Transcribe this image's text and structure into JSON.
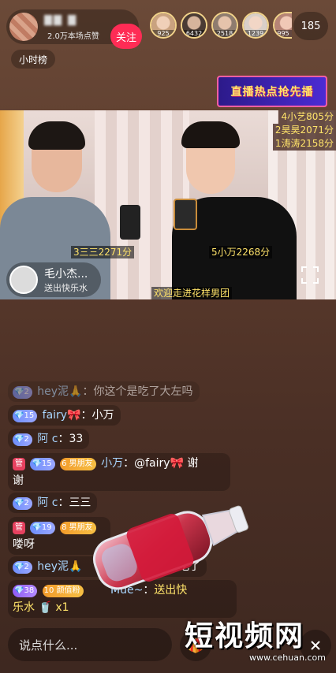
{
  "host": {
    "name": "▇▇  ▇",
    "likes": "2.0万本场点赞",
    "follow_label": "关注"
  },
  "viewers": [
    {
      "count": "925",
      "color": "#c9a27f"
    },
    {
      "count": "6432",
      "color": "#4a3b34"
    },
    {
      "count": "2518",
      "color": "#8e7c6f"
    },
    {
      "count": "1239",
      "color": "#d9cfc8"
    },
    {
      "count": "995",
      "color": "#b68476"
    }
  ],
  "viewer_total": "185",
  "hour_rank_label": "小时榜",
  "promo_label": "直播热点抢先播",
  "scores_top": [
    "4小艺805分",
    "2昊昊2071分",
    "1涛涛2158分"
  ],
  "video": {
    "score_left": "3三三2271分",
    "score_right": "5小万2268分",
    "guest_name": "毛小杰...",
    "guest_sub": "送出快乐水",
    "welcome": "欢迎走进花样男团"
  },
  "chat": [
    {
      "level": "2",
      "user": "hey泥",
      "emoji": "🙏",
      "text": "你这个是吃了大左吗",
      "dim": true
    },
    {
      "level": "15",
      "user": "fairy",
      "emoji": "🎀",
      "text": "小万"
    },
    {
      "level": "2",
      "user": "阿 c",
      "text": "33"
    },
    {
      "guan": "管",
      "level": "15",
      "fan_level": "6",
      "fan_group": "男朋友",
      "user": "小万",
      "text": "@fairy🎀 谢",
      "text2": "谢"
    },
    {
      "level": "2",
      "user": "阿 c",
      "text": "三三"
    },
    {
      "guan": "管",
      "level": "19",
      "fan_level": "8",
      "fan_group": "男朋友",
      "text2": "喽呀"
    },
    {
      "level": "2",
      "user": "hey泥",
      "emoji": "🙏",
      "text": "",
      "tail": "吃了"
    },
    {
      "level": "38",
      "fan_level": "10",
      "fan_group": "颜值粉",
      "user": "Mue~",
      "text": "送出快",
      "text2": "乐水",
      "gift_count": "x1"
    }
  ],
  "bottom": {
    "input_placeholder": "说点什么...",
    "close_icon": "close-icon"
  },
  "watermark": {
    "text": "短视频网",
    "url": "www.cehuan.com"
  },
  "colors": {
    "follow": "#fe2c55",
    "score": "#ffe36a",
    "username": "#a9d6ff"
  }
}
